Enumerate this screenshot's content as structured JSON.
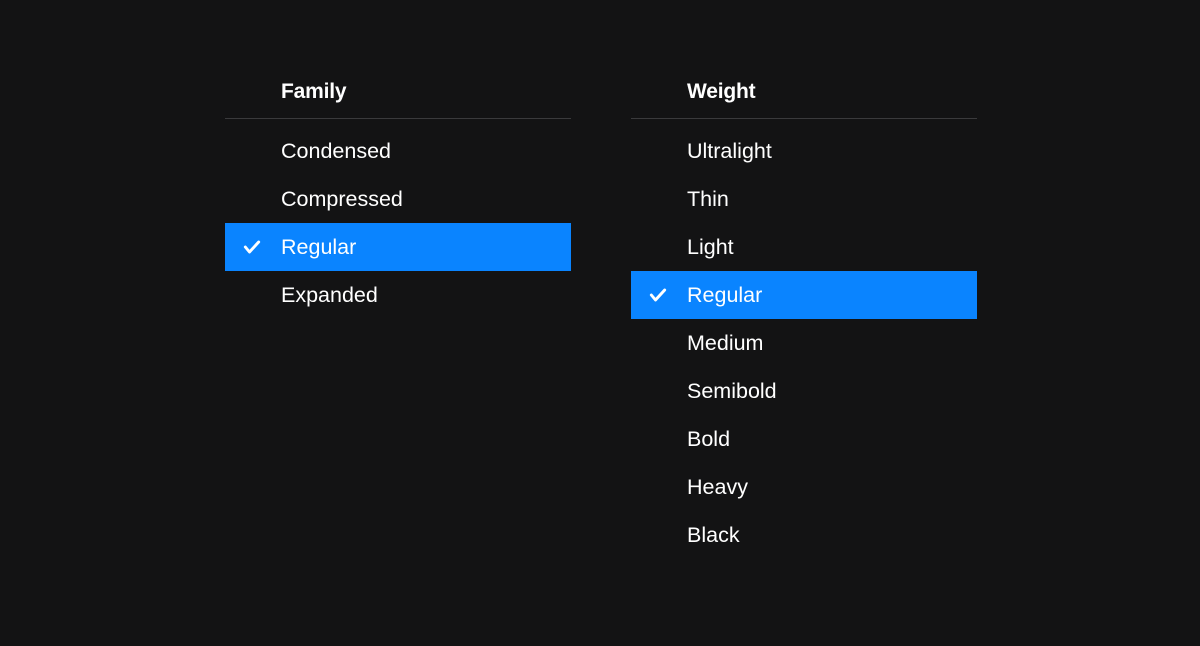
{
  "family": {
    "header": "Family",
    "items": [
      {
        "label": "Condensed",
        "selected": false
      },
      {
        "label": "Compressed",
        "selected": false
      },
      {
        "label": "Regular",
        "selected": true
      },
      {
        "label": "Expanded",
        "selected": false
      }
    ]
  },
  "weight": {
    "header": "Weight",
    "items": [
      {
        "label": "Ultralight",
        "selected": false
      },
      {
        "label": "Thin",
        "selected": false
      },
      {
        "label": "Light",
        "selected": false
      },
      {
        "label": "Regular",
        "selected": true
      },
      {
        "label": "Medium",
        "selected": false
      },
      {
        "label": "Semibold",
        "selected": false
      },
      {
        "label": "Bold",
        "selected": false
      },
      {
        "label": "Heavy",
        "selected": false
      },
      {
        "label": "Black",
        "selected": false
      }
    ]
  }
}
